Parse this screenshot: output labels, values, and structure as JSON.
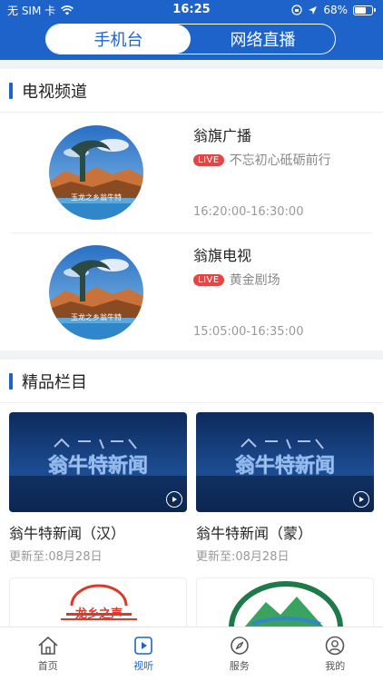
{
  "status": {
    "carrier": "无 SIM 卡",
    "time": "16:25",
    "battery": "68%",
    "battery_level": 0.68
  },
  "segment": {
    "tabs": [
      {
        "label": "手机台",
        "active": true
      },
      {
        "label": "网络直播",
        "active": false
      }
    ]
  },
  "tv_section": {
    "title": "电视频道",
    "live_badge": "LIVE",
    "thumb_caption": "玉龙之乡翁牛特",
    "channels": [
      {
        "name": "翁旗广播",
        "program": "不忘初心砥砺前行",
        "time": "16:20:00-16:30:00"
      },
      {
        "name": "翁旗电视",
        "program": "黄金剧场",
        "time": "15:05:00-16:35:00"
      }
    ]
  },
  "featured_section": {
    "title": "精品栏目",
    "poster_text": "翁牛特新闻",
    "items": [
      {
        "title": "翁牛特新闻（汉）",
        "update": "更新至:08月28日"
      },
      {
        "title": "翁牛特新闻（蒙）",
        "update": "更新至:08月28日"
      }
    ],
    "partial_cards": [
      {
        "logo_text": "龙乡之声"
      },
      {
        "logo_icon": "mountain-logo"
      }
    ]
  },
  "tabbar": {
    "items": [
      {
        "label": "首页",
        "icon": "home-icon",
        "active": false
      },
      {
        "label": "视听",
        "icon": "play-icon",
        "active": true
      },
      {
        "label": "服务",
        "icon": "compass-icon",
        "active": false
      },
      {
        "label": "我的",
        "icon": "user-icon",
        "active": false
      }
    ]
  },
  "colors": {
    "brand": "#1e63c9",
    "live": "#e64545",
    "background": "#f2f3f5"
  }
}
